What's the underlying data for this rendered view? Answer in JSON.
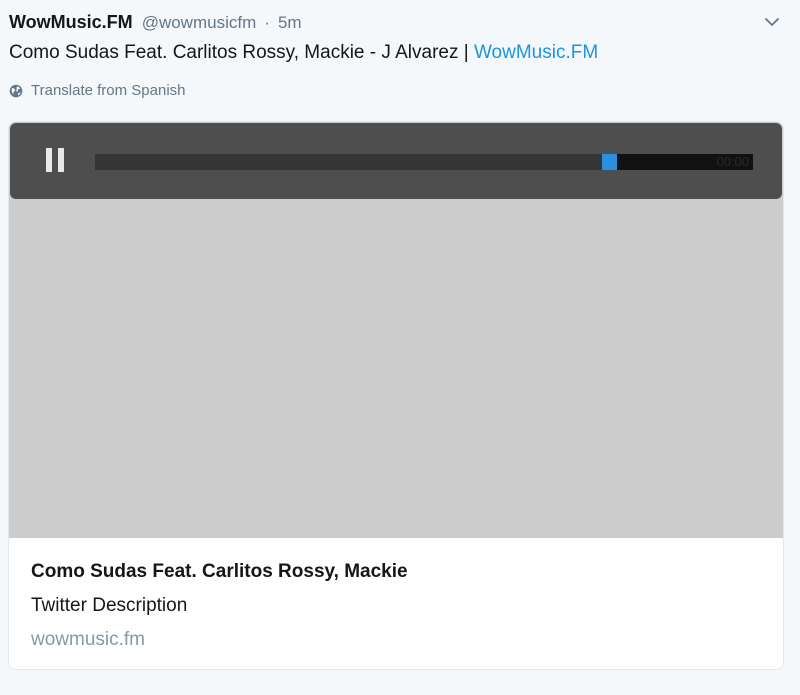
{
  "tweet": {
    "display_name": "WowMusic.FM",
    "handle": "@wowmusicfm",
    "separator": "·",
    "time": "5m",
    "text": "Como Sudas Feat. Carlitos Rossy, Mackie - J Alvarez | ",
    "link_text": "WowMusic.FM",
    "translate_label": "Translate from Spanish",
    "caret_icon": "chevron-down-icon",
    "globe_icon": "globe-icon"
  },
  "card": {
    "player": {
      "state": "playing",
      "pause_icon": "pause-icon",
      "progress": 0.77,
      "time_readout": "00:00"
    },
    "title": "Como Sudas Feat. Carlitos Rossy, Mackie",
    "description": "Twitter Description",
    "domain": "wowmusic.fm"
  },
  "colors": {
    "link": "#1b95e0",
    "playhead": "#2b8fde",
    "player_bar": "#4e4e4e",
    "media_bg": "#cdcdcd"
  }
}
